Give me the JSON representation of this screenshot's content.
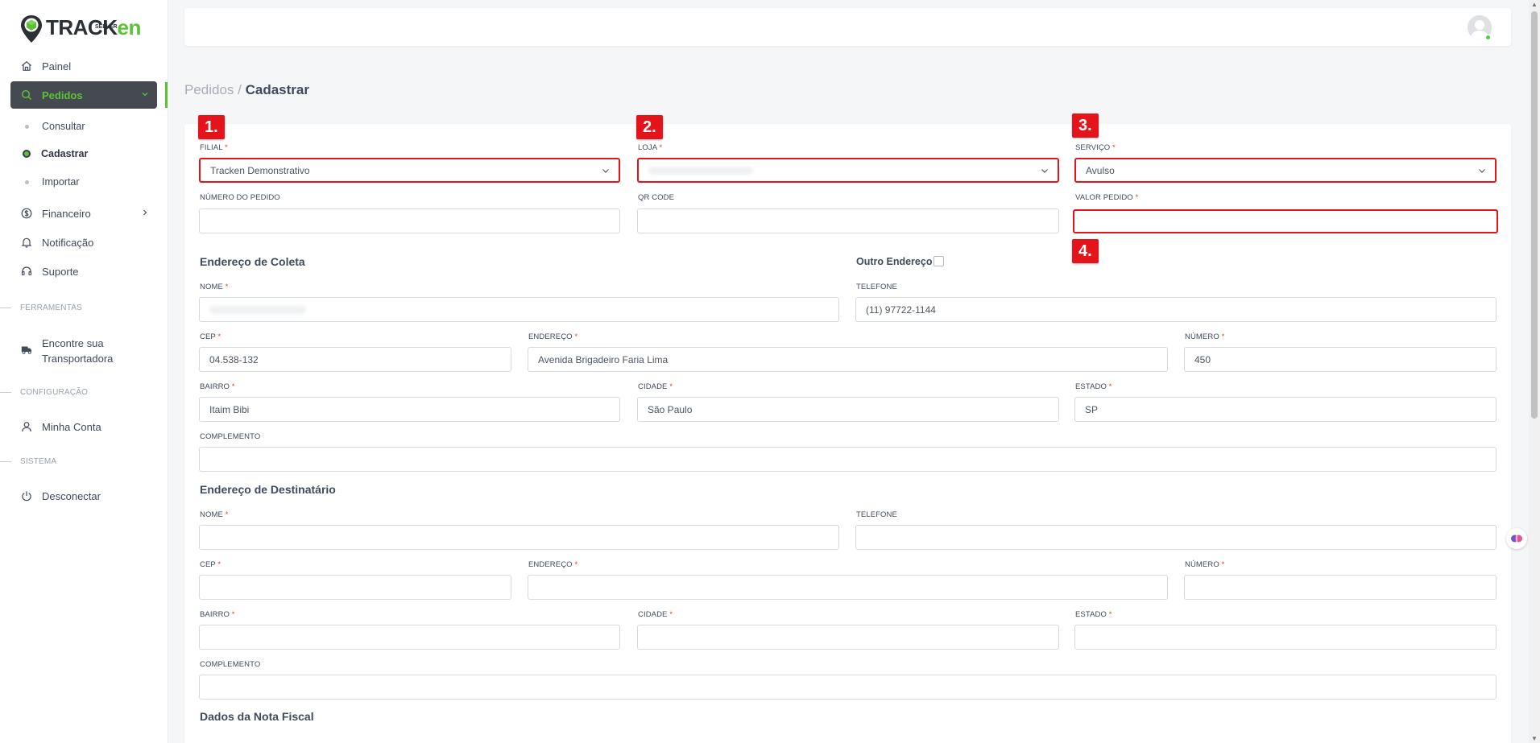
{
  "brand": {
    "name_a": "TRACK",
    "name_b": "en",
    "sub": "SELLER"
  },
  "sidebar": {
    "items": [
      {
        "label": "Painel"
      },
      {
        "label": "Pedidos"
      },
      {
        "label": "Financeiro"
      },
      {
        "label": "Notificação"
      },
      {
        "label": "Suporte"
      },
      {
        "label": "Encontre sua Transportadora"
      },
      {
        "label": "Minha Conta"
      },
      {
        "label": "Desconectar"
      }
    ],
    "subitems": [
      {
        "label": "Consultar"
      },
      {
        "label": "Cadastrar"
      },
      {
        "label": "Importar"
      }
    ],
    "sections": [
      "FERRAMENTAS",
      "CONFIGURAÇÃO",
      "SISTEMA"
    ]
  },
  "breadcrumb": {
    "parent": "Pedidos",
    "separator": " / ",
    "current": "Cadastrar"
  },
  "form": {
    "filial": {
      "label": "FILIAL",
      "value": "Tracken Demonstrativo"
    },
    "loja": {
      "label": "LOJA",
      "value": ""
    },
    "servico": {
      "label": "SERVIÇO",
      "value": "Avulso"
    },
    "numero_pedido": {
      "label": "NÚMERO DO PEDIDO",
      "value": ""
    },
    "qr_code": {
      "label": "QR CODE",
      "value": ""
    },
    "valor_pedido": {
      "label": "VALOR PEDIDO",
      "value": ""
    },
    "coleta": {
      "title": "Endereço de Coleta",
      "outro_endereco": "Outro Endereço",
      "nome": {
        "label": "NOME",
        "value": ""
      },
      "telefone": {
        "label": "TELEFONE",
        "value": "(11) 97722-1144"
      },
      "cep": {
        "label": "CEP",
        "value": "04.538-132"
      },
      "endereco": {
        "label": "ENDEREÇO",
        "value": "Avenida Brigadeiro Faria Lima"
      },
      "numero": {
        "label": "NÚMERO",
        "value": "450"
      },
      "bairro": {
        "label": "BAIRRO",
        "value": "Itaim Bibi"
      },
      "cidade": {
        "label": "CIDADE",
        "value": "São Paulo"
      },
      "estado": {
        "label": "ESTADO",
        "value": "SP"
      },
      "complemento": {
        "label": "COMPLEMENTO",
        "value": ""
      }
    },
    "destinatario": {
      "title": "Endereço de Destinatário",
      "nome": {
        "label": "NOME",
        "value": ""
      },
      "telefone": {
        "label": "TELEFONE",
        "value": ""
      },
      "cep": {
        "label": "CEP",
        "value": ""
      },
      "endereco": {
        "label": "ENDEREÇO",
        "value": ""
      },
      "numero": {
        "label": "NÚMERO",
        "value": ""
      },
      "bairro": {
        "label": "BAIRRO",
        "value": ""
      },
      "cidade": {
        "label": "CIDADE",
        "value": ""
      },
      "estado": {
        "label": "ESTADO",
        "value": ""
      },
      "complemento": {
        "label": "COMPLEMENTO",
        "value": ""
      }
    },
    "nota_fiscal_title": "Dados da Nota Fiscal",
    "required_mark": "*"
  },
  "annotations": [
    "1.",
    "2.",
    "3.",
    "4."
  ],
  "colors": {
    "accent": "#5bc236",
    "highlight": "#e5141a",
    "sidebar_active": "#454a52"
  },
  "icons": [
    "home-icon",
    "search-icon",
    "dollar-icon",
    "bell-icon",
    "headset-icon",
    "truck-icon",
    "user-icon",
    "power-icon",
    "chevron-down-icon",
    "chevron-right-icon",
    "avatar-icon"
  ]
}
